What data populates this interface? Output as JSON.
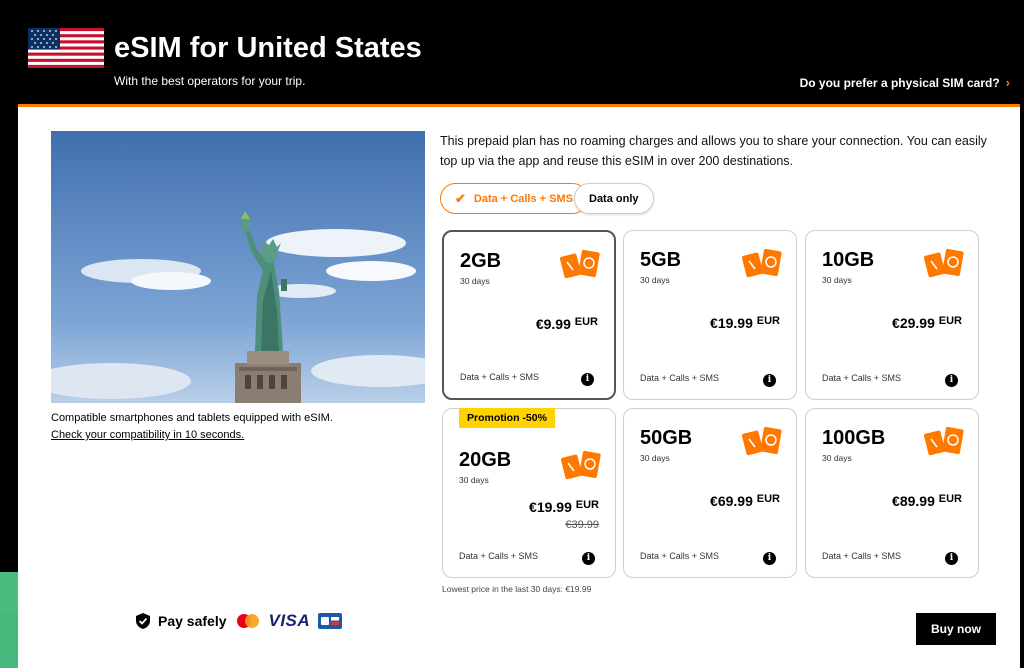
{
  "header": {
    "title": "eSIM for United States",
    "subtitle": "With the best operators for your trip.",
    "physical_sim_link": "Do you prefer a physical SIM card?"
  },
  "colors": {
    "accent": "#ff7900",
    "promo": "#ffd200",
    "dark": "#000000"
  },
  "compat": {
    "line1": "Compatible smartphones and tablets equipped with eSIM.",
    "link": "Check your compatibility in 10 seconds."
  },
  "description": "This prepaid plan has no roaming charges and allows you to share your connection. You can easily top up via the app and reuse this eSIM in over 200 destinations.",
  "filters": [
    {
      "label": "Data + Calls + SMS",
      "selected": true
    },
    {
      "label": "Data only",
      "selected": false
    }
  ],
  "plans": [
    {
      "gb": "2GB",
      "days": "30 days",
      "price": "€9.99",
      "currency": "EUR",
      "features": "Data + Calls + SMS",
      "selected": true
    },
    {
      "gb": "5GB",
      "days": "30 days",
      "price": "€19.99",
      "currency": "EUR",
      "features": "Data + Calls + SMS"
    },
    {
      "gb": "10GB",
      "days": "30 days",
      "price": "€29.99",
      "currency": "EUR",
      "features": "Data + Calls + SMS"
    },
    {
      "gb": "20GB",
      "days": "30 days",
      "price": "€19.99",
      "currency": "EUR",
      "old_price": "€39.99",
      "promo": "Promotion -50%",
      "features": "Data + Calls + SMS"
    },
    {
      "gb": "50GB",
      "days": "30 days",
      "price": "€69.99",
      "currency": "EUR",
      "features": "Data + Calls + SMS"
    },
    {
      "gb": "100GB",
      "days": "30 days",
      "price": "€89.99",
      "currency": "EUR",
      "features": "Data + Calls + SMS"
    }
  ],
  "lowest_price_note": "Lowest price in the last 30 days: €19.99",
  "payment": {
    "label": "Pay safely",
    "visa": "VISA",
    "icons": [
      "shield-check-icon",
      "mastercard-icon",
      "visa-logo",
      "cb-card-icon"
    ]
  },
  "buy_button": "Buy now",
  "info_glyph": "i"
}
